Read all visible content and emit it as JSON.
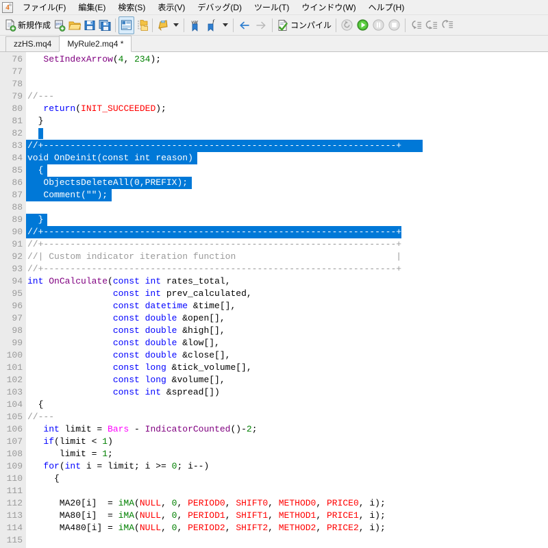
{
  "app": {
    "icon_name": "metaeditor4-icon",
    "icon_text": "4"
  },
  "menubar": {
    "items": [
      {
        "label": "ファイル(F)",
        "name": "menu-file"
      },
      {
        "label": "編集(E)",
        "name": "menu-edit"
      },
      {
        "label": "検索(S)",
        "name": "menu-search"
      },
      {
        "label": "表示(V)",
        "name": "menu-view"
      },
      {
        "label": "デバッグ(D)",
        "name": "menu-debug"
      },
      {
        "label": "ツール(T)",
        "name": "menu-tools"
      },
      {
        "label": "ウインドウ(W)",
        "name": "menu-window"
      },
      {
        "label": "ヘルプ(H)",
        "name": "menu-help"
      }
    ]
  },
  "toolbar": {
    "new_label": "新規作成",
    "compile_label": "コンパイル",
    "buttons": [
      {
        "name": "new-file-button",
        "icon": "new-document-icon"
      },
      {
        "name": "new-project-button",
        "icon": "project-add-icon"
      },
      {
        "name": "open-button",
        "icon": "folder-open-icon"
      },
      {
        "name": "save-button",
        "icon": "floppy-save-icon"
      },
      {
        "name": "save-all-button",
        "icon": "floppy-save-all-icon"
      },
      {
        "name": "navigator-toggle-button",
        "icon": "navigator-panel-icon"
      },
      {
        "name": "toolbox-toggle-button",
        "icon": "folder-tree-icon"
      },
      {
        "name": "styler-button",
        "icon": "palette-icon"
      },
      {
        "name": "insert-variable-button",
        "icon": "var-bookmark-icon"
      },
      {
        "name": "insert-function-button",
        "icon": "function-bookmark-icon"
      },
      {
        "name": "back-button",
        "icon": "arrow-left-icon"
      },
      {
        "name": "forward-button",
        "icon": "arrow-right-icon"
      },
      {
        "name": "compile-button",
        "icon": "compile-check-icon"
      },
      {
        "name": "restart-button",
        "icon": "restart-icon"
      },
      {
        "name": "start-button",
        "icon": "play-icon"
      },
      {
        "name": "pause-button",
        "icon": "pause-icon"
      },
      {
        "name": "stop-button",
        "icon": "stop-icon"
      },
      {
        "name": "step-into-button",
        "icon": "step-into-icon"
      },
      {
        "name": "step-over-button",
        "icon": "step-over-icon"
      },
      {
        "name": "step-out-button",
        "icon": "step-out-icon"
      }
    ]
  },
  "tabs": [
    {
      "label": "zzHS.mq4",
      "name": "tab-zzhs",
      "selected": false
    },
    {
      "label": "MyRule2.mq4 *",
      "name": "tab-myrule2",
      "selected": true
    }
  ],
  "colors": {
    "keyword": "#0000ff",
    "function": "#800080",
    "number": "#008000",
    "comment": "#9a9a9a",
    "constant": "#ff0000",
    "property": "#ff00ff",
    "builtin": "#008000",
    "selection_bg": "#0078d7",
    "gutter_bg": "#ebebeb",
    "gutter_fg": "#9a9a9a",
    "accent": "#0078d7"
  },
  "editor": {
    "first_line": 76,
    "lines": [
      {
        "n": 76,
        "sel": false,
        "tokens": [
          [
            "pl",
            "   "
          ],
          [
            "fn",
            "SetIndexArrow"
          ],
          [
            "pn",
            "("
          ],
          [
            "num",
            "4"
          ],
          [
            "pn",
            ", "
          ],
          [
            "num",
            "234"
          ],
          [
            "pn",
            ");"
          ]
        ]
      },
      {
        "n": 77,
        "sel": false,
        "tokens": []
      },
      {
        "n": 78,
        "sel": false,
        "tokens": []
      },
      {
        "n": 79,
        "sel": false,
        "tokens": [
          [
            "cm",
            "//---"
          ]
        ]
      },
      {
        "n": 80,
        "sel": false,
        "tokens": [
          [
            "pl",
            "   "
          ],
          [
            "kw",
            "return"
          ],
          [
            "pn",
            "("
          ],
          [
            "cst",
            "INIT_SUCCEEDED"
          ],
          [
            "pn",
            ");"
          ]
        ]
      },
      {
        "n": 81,
        "sel": false,
        "tokens": [
          [
            "pl",
            "  }"
          ]
        ]
      },
      {
        "n": 82,
        "sel": false,
        "caret": true,
        "tokens": [
          [
            "pl",
            "  "
          ]
        ]
      },
      {
        "n": 83,
        "sel": true,
        "selpad": 4,
        "tokens": [
          [
            "cm",
            "//+------------------------------------------------------------------+"
          ]
        ]
      },
      {
        "n": 84,
        "sel": true,
        "selpad": 1,
        "tokens": [
          [
            "kw",
            "void"
          ],
          [
            "pl",
            " "
          ],
          [
            "fn",
            "OnDeinit"
          ],
          [
            "pn",
            "("
          ],
          [
            "kw",
            "const int"
          ],
          [
            "pl",
            " reason"
          ],
          [
            "pn",
            ")"
          ]
        ]
      },
      {
        "n": 85,
        "sel": true,
        "selpad": 1,
        "tokens": [
          [
            "pl",
            "  {"
          ]
        ]
      },
      {
        "n": 86,
        "sel": true,
        "selpad": 1,
        "tokens": [
          [
            "pl",
            "   "
          ],
          [
            "bif",
            "ObjectsDeleteAll"
          ],
          [
            "pn",
            "("
          ],
          [
            "num",
            "0"
          ],
          [
            "pn",
            ","
          ],
          [
            "cst",
            "PREFIX"
          ],
          [
            "pn",
            ");"
          ]
        ]
      },
      {
        "n": 87,
        "sel": true,
        "selpad": 1,
        "tokens": [
          [
            "pl",
            "   "
          ],
          [
            "bif",
            "Comment"
          ],
          [
            "pn",
            "("
          ],
          [
            "cst",
            "\"\""
          ],
          [
            "pn",
            ");"
          ]
        ]
      },
      {
        "n": 88,
        "sel": true,
        "selpad": 1,
        "tokens": [
          [
            "pl",
            ""
          ]
        ]
      },
      {
        "n": 89,
        "sel": true,
        "selpad": 1,
        "tokens": [
          [
            "pl",
            "  }"
          ]
        ]
      },
      {
        "n": 90,
        "sel": true,
        "selpad": 0,
        "tokens": [
          [
            "cm",
            "//+------------------------------------------------------------------+"
          ]
        ]
      },
      {
        "n": 91,
        "sel": false,
        "tokens": [
          [
            "cm",
            "//+------------------------------------------------------------------+"
          ]
        ]
      },
      {
        "n": 92,
        "sel": false,
        "tokens": [
          [
            "cm",
            "//| Custom indicator iteration function                              |"
          ]
        ]
      },
      {
        "n": 93,
        "sel": false,
        "tokens": [
          [
            "cm",
            "//+------------------------------------------------------------------+"
          ]
        ]
      },
      {
        "n": 94,
        "sel": false,
        "tokens": [
          [
            "kw",
            "int"
          ],
          [
            "pl",
            " "
          ],
          [
            "fn",
            "OnCalculate"
          ],
          [
            "pn",
            "("
          ],
          [
            "kw",
            "const int"
          ],
          [
            "pl",
            " rates_total,"
          ]
        ]
      },
      {
        "n": 95,
        "sel": false,
        "tokens": [
          [
            "pl",
            "                "
          ],
          [
            "kw",
            "const int"
          ],
          [
            "pl",
            " prev_calculated,"
          ]
        ]
      },
      {
        "n": 96,
        "sel": false,
        "tokens": [
          [
            "pl",
            "                "
          ],
          [
            "kw",
            "const datetime"
          ],
          [
            "pl",
            " &time[],"
          ]
        ]
      },
      {
        "n": 97,
        "sel": false,
        "tokens": [
          [
            "pl",
            "                "
          ],
          [
            "kw",
            "const double"
          ],
          [
            "pl",
            " &open[],"
          ]
        ]
      },
      {
        "n": 98,
        "sel": false,
        "tokens": [
          [
            "pl",
            "                "
          ],
          [
            "kw",
            "const double"
          ],
          [
            "pl",
            " &high[],"
          ]
        ]
      },
      {
        "n": 99,
        "sel": false,
        "tokens": [
          [
            "pl",
            "                "
          ],
          [
            "kw",
            "const double"
          ],
          [
            "pl",
            " &low[],"
          ]
        ]
      },
      {
        "n": 100,
        "sel": false,
        "tokens": [
          [
            "pl",
            "                "
          ],
          [
            "kw",
            "const double"
          ],
          [
            "pl",
            " &close[],"
          ]
        ]
      },
      {
        "n": 101,
        "sel": false,
        "tokens": [
          [
            "pl",
            "                "
          ],
          [
            "kw",
            "const long"
          ],
          [
            "pl",
            " &tick_volume[],"
          ]
        ]
      },
      {
        "n": 102,
        "sel": false,
        "tokens": [
          [
            "pl",
            "                "
          ],
          [
            "kw",
            "const long"
          ],
          [
            "pl",
            " &volume[],"
          ]
        ]
      },
      {
        "n": 103,
        "sel": false,
        "tokens": [
          [
            "pl",
            "                "
          ],
          [
            "kw",
            "const int"
          ],
          [
            "pl",
            " &spread[])"
          ]
        ]
      },
      {
        "n": 104,
        "sel": false,
        "tokens": [
          [
            "pl",
            "  {"
          ]
        ]
      },
      {
        "n": 105,
        "sel": false,
        "tokens": [
          [
            "cm",
            "//---"
          ]
        ]
      },
      {
        "n": 106,
        "sel": false,
        "tokens": [
          [
            "pl",
            "   "
          ],
          [
            "kw",
            "int"
          ],
          [
            "pl",
            " limit = "
          ],
          [
            "prop",
            "Bars"
          ],
          [
            "pl",
            " - "
          ],
          [
            "fn",
            "IndicatorCounted"
          ],
          [
            "pn",
            "()-"
          ],
          [
            "num",
            "2"
          ],
          [
            "pn",
            ";"
          ]
        ]
      },
      {
        "n": 107,
        "sel": false,
        "tokens": [
          [
            "pl",
            "   "
          ],
          [
            "kw",
            "if"
          ],
          [
            "pn",
            "("
          ],
          [
            "pl",
            "limit < "
          ],
          [
            "num",
            "1"
          ],
          [
            "pn",
            ")"
          ]
        ]
      },
      {
        "n": 108,
        "sel": false,
        "tokens": [
          [
            "pl",
            "      limit = "
          ],
          [
            "num",
            "1"
          ],
          [
            "pn",
            ";"
          ]
        ]
      },
      {
        "n": 109,
        "sel": false,
        "tokens": [
          [
            "pl",
            "   "
          ],
          [
            "kw",
            "for"
          ],
          [
            "pn",
            "("
          ],
          [
            "kw",
            "int"
          ],
          [
            "pl",
            " i = limit; i >= "
          ],
          [
            "num",
            "0"
          ],
          [
            "pl",
            "; i--"
          ],
          [
            "pn",
            ")"
          ]
        ]
      },
      {
        "n": 110,
        "sel": false,
        "tokens": [
          [
            "pl",
            "     {"
          ]
        ]
      },
      {
        "n": 111,
        "sel": false,
        "tokens": []
      },
      {
        "n": 112,
        "sel": false,
        "tokens": [
          [
            "pl",
            "      MA20[i]  = "
          ],
          [
            "bif",
            "iMA"
          ],
          [
            "pn",
            "("
          ],
          [
            "cst",
            "NULL"
          ],
          [
            "pn",
            ", "
          ],
          [
            "num",
            "0"
          ],
          [
            "pn",
            ", "
          ],
          [
            "cst",
            "PERIOD0"
          ],
          [
            "pn",
            ", "
          ],
          [
            "cst",
            "SHIFT0"
          ],
          [
            "pn",
            ", "
          ],
          [
            "cst",
            "METHOD0"
          ],
          [
            "pn",
            ", "
          ],
          [
            "cst",
            "PRICE0"
          ],
          [
            "pn",
            ", i);"
          ]
        ]
      },
      {
        "n": 113,
        "sel": false,
        "tokens": [
          [
            "pl",
            "      MA80[i]  = "
          ],
          [
            "bif",
            "iMA"
          ],
          [
            "pn",
            "("
          ],
          [
            "cst",
            "NULL"
          ],
          [
            "pn",
            ", "
          ],
          [
            "num",
            "0"
          ],
          [
            "pn",
            ", "
          ],
          [
            "cst",
            "PERIOD1"
          ],
          [
            "pn",
            ", "
          ],
          [
            "cst",
            "SHIFT1"
          ],
          [
            "pn",
            ", "
          ],
          [
            "cst",
            "METHOD1"
          ],
          [
            "pn",
            ", "
          ],
          [
            "cst",
            "PRICE1"
          ],
          [
            "pn",
            ", i);"
          ]
        ]
      },
      {
        "n": 114,
        "sel": false,
        "tokens": [
          [
            "pl",
            "      MA480[i] = "
          ],
          [
            "bif",
            "iMA"
          ],
          [
            "pn",
            "("
          ],
          [
            "cst",
            "NULL"
          ],
          [
            "pn",
            ", "
          ],
          [
            "num",
            "0"
          ],
          [
            "pn",
            ", "
          ],
          [
            "cst",
            "PERIOD2"
          ],
          [
            "pn",
            ", "
          ],
          [
            "cst",
            "SHIFT2"
          ],
          [
            "pn",
            ", "
          ],
          [
            "cst",
            "METHOD2"
          ],
          [
            "pn",
            ", "
          ],
          [
            "cst",
            "PRICE2"
          ],
          [
            "pn",
            ", i);"
          ]
        ]
      },
      {
        "n": 115,
        "sel": false,
        "tokens": []
      }
    ]
  }
}
